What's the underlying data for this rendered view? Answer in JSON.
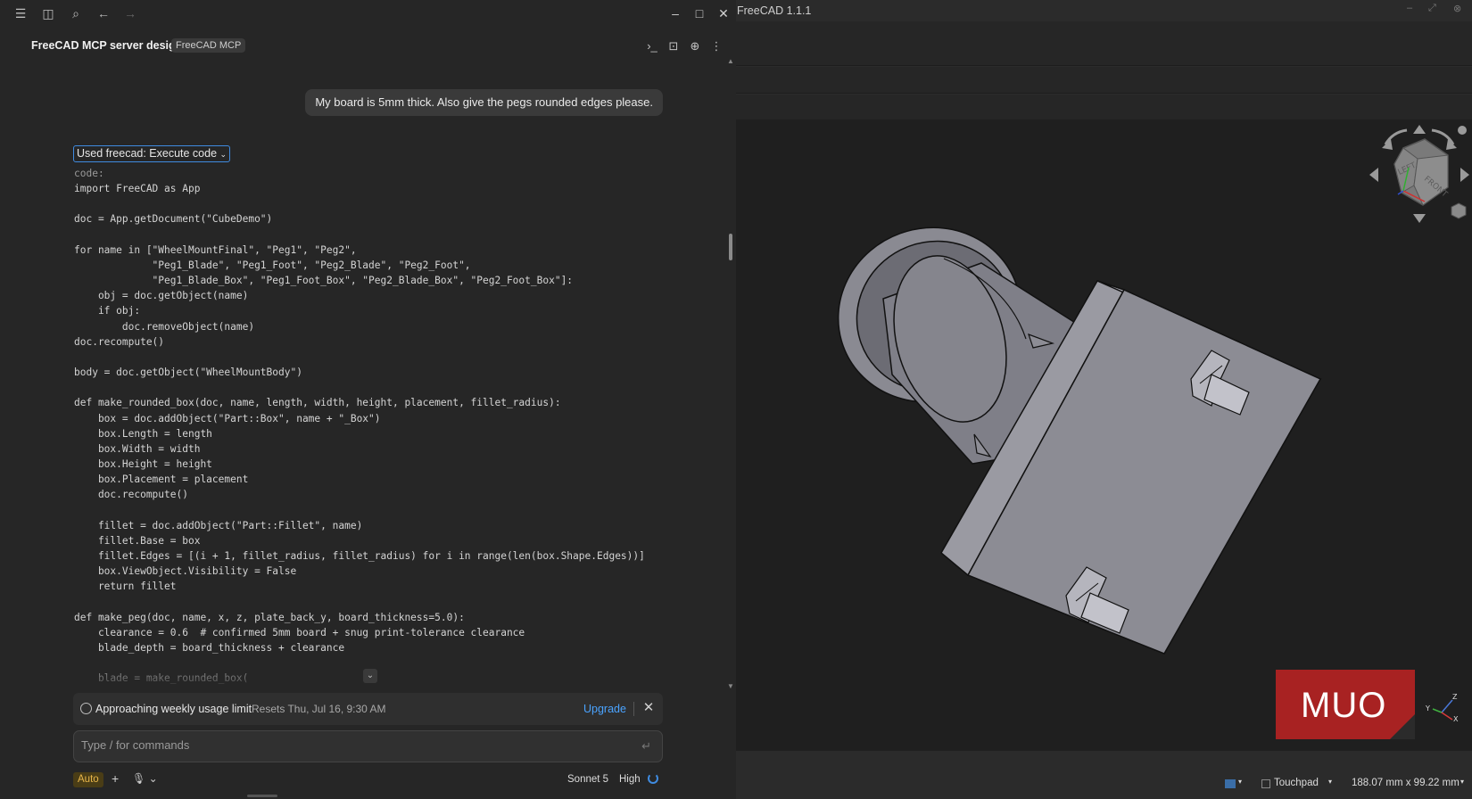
{
  "chat": {
    "title": "FreeCAD MCP server design",
    "badge": "FreeCAD MCP",
    "user_message": "My board is 5mm thick. Also give the pegs rounded edges please.",
    "tool_chip": "Used freecad: Execute code",
    "code_lines": [
      "code:",
      "import FreeCAD as App",
      "",
      "doc = App.getDocument(\"CubeDemo\")",
      "",
      "for name in [\"WheelMountFinal\", \"Peg1\", \"Peg2\",",
      "             \"Peg1_Blade\", \"Peg1_Foot\", \"Peg2_Blade\", \"Peg2_Foot\",",
      "             \"Peg1_Blade_Box\", \"Peg1_Foot_Box\", \"Peg2_Blade_Box\", \"Peg2_Foot_Box\"]:",
      "    obj = doc.getObject(name)",
      "    if obj:",
      "        doc.removeObject(name)",
      "doc.recompute()",
      "",
      "body = doc.getObject(\"WheelMountBody\")",
      "",
      "def make_rounded_box(doc, name, length, width, height, placement, fillet_radius):",
      "    box = doc.addObject(\"Part::Box\", name + \"_Box\")",
      "    box.Length = length",
      "    box.Width = width",
      "    box.Height = height",
      "    box.Placement = placement",
      "    doc.recompute()",
      "",
      "    fillet = doc.addObject(\"Part::Fillet\", name)",
      "    fillet.Base = box",
      "    fillet.Edges = [(i + 1, fillet_radius, fillet_radius) for i in range(len(box.Shape.Edges))]",
      "    box.ViewObject.Visibility = False",
      "    return fillet",
      "",
      "def make_peg(doc, name, x, z, plate_back_y, board_thickness=5.0):",
      "    clearance = 0.6  # confirmed 5mm board + snug print-tolerance clearance",
      "    blade_depth = board_thickness + clearance",
      "",
      "    blade = make_rounded_box("
    ],
    "limit": {
      "text": "Approaching weekly usage limit",
      "resets": "Resets Thu, Jul 16, 9:30 AM",
      "upgrade": "Upgrade"
    },
    "composer": {
      "placeholder": "Type / for commands"
    },
    "mode": "Auto",
    "model": "Sonnet 5",
    "effort": "High",
    "accent_color": "#3f8be0"
  },
  "freecad": {
    "title": "FreeCAD 1.1.1",
    "navcube_faces": [
      "LEFT",
      "FRONT"
    ],
    "status": {
      "input_mode": "Touchpad",
      "dimensions": "188.07 mm x 99.22 mm"
    },
    "axes": [
      "Z",
      "Y",
      "X"
    ]
  },
  "watermark": {
    "text": "MUO",
    "color": "#a82222"
  },
  "icons": [
    "hamburger-icon",
    "sidebar-icon",
    "search-icon",
    "back-icon",
    "forward-icon",
    "minimize-icon",
    "maximize-icon",
    "close-icon",
    "terminal-icon",
    "export-icon",
    "globe-icon",
    "more-icon",
    "clock-icon",
    "send-icon",
    "plus-icon",
    "mic-icon",
    "spinner-icon"
  ]
}
